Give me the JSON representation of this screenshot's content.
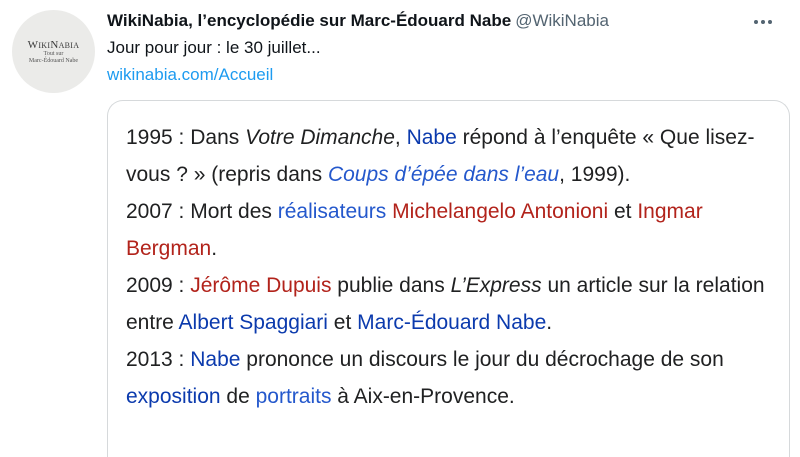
{
  "avatar": {
    "logo_name": "WikiNabia",
    "logo_line1": "Tout sur",
    "logo_line2": "Marc-Édouard Nabe"
  },
  "header": {
    "display_name": "WikiNabia, l’encyclopédie sur Marc-Édouard Nabe",
    "handle": "@WikiNabia",
    "more_icon": "more-horizontal-icon"
  },
  "tweet": {
    "text": "Jour pour jour : le 30 juillet...",
    "link": "wikinabia.com/Accueil"
  },
  "card": {
    "entries": [
      {
        "segments": [
          {
            "t": "1995 : Dans ",
            "s": "plain"
          },
          {
            "t": "Votre Dimanche",
            "s": "italic"
          },
          {
            "t": ", ",
            "s": "plain"
          },
          {
            "t": "Nabe",
            "s": "blue"
          },
          {
            "t": " répond à l’enquête « Que lisez-vous ? » (repris dans ",
            "s": "plain"
          },
          {
            "t": "Coups d’épée dans l’eau",
            "s": "italic-link"
          },
          {
            "t": ", 1999).",
            "s": "plain"
          }
        ]
      },
      {
        "segments": [
          {
            "t": "2007 : Mort des ",
            "s": "plain"
          },
          {
            "t": "réalisateurs",
            "s": "link"
          },
          {
            "t": " ",
            "s": "plain"
          },
          {
            "t": "Michelangelo Antonioni",
            "s": "red"
          },
          {
            "t": " et ",
            "s": "plain"
          },
          {
            "t": "Ingmar Bergman",
            "s": "red"
          },
          {
            "t": ".",
            "s": "plain"
          }
        ]
      },
      {
        "segments": [
          {
            "t": "2009 : ",
            "s": "plain"
          },
          {
            "t": "Jérôme Dupuis",
            "s": "red"
          },
          {
            "t": " publie dans ",
            "s": "plain"
          },
          {
            "t": "L’Express",
            "s": "italic"
          },
          {
            "t": " un article sur la relation entre ",
            "s": "plain"
          },
          {
            "t": "Albert Spaggiari",
            "s": "blue"
          },
          {
            "t": " et ",
            "s": "plain"
          },
          {
            "t": "Marc-Édouard Nabe",
            "s": "blue"
          },
          {
            "t": ".",
            "s": "plain"
          }
        ]
      },
      {
        "segments": [
          {
            "t": "2013 : ",
            "s": "plain"
          },
          {
            "t": "Nabe",
            "s": "blue"
          },
          {
            "t": " prononce un discours le jour du décrochage de son ",
            "s": "plain"
          },
          {
            "t": "exposition",
            "s": "blue"
          },
          {
            "t": " de ",
            "s": "plain"
          },
          {
            "t": "portraits",
            "s": "link"
          },
          {
            "t": " à Aix-en-Provence.",
            "s": "plain"
          }
        ]
      }
    ]
  },
  "colors": {
    "twitter_blue": "#1d9bf0",
    "wiki_blue": "#0b3aad",
    "wiki_link": "#2458cc",
    "wiki_red": "#b2231b",
    "muted": "#536471"
  }
}
